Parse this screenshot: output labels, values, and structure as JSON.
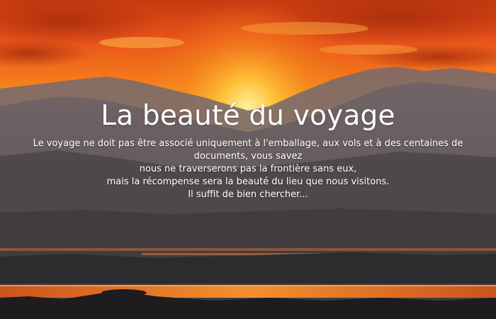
{
  "hero": {
    "title": "La beauté du voyage",
    "lines": [
      "Le voyage ne doit pas être associé uniquement à l'emballage, aux vols et à des centaines de documents, vous savez",
      "nous ne traverserons pas la frontière sans eux,",
      "mais la récompense sera la beauté du lieu que nous visitons.",
      "Il suffit de bien chercher..."
    ]
  },
  "colors": {
    "sky_top": "#e8511a",
    "sun_glow": "#ffc43a",
    "mountains": "#5a5558",
    "water_glow": "#f07a2a",
    "text": "#ffffff"
  }
}
